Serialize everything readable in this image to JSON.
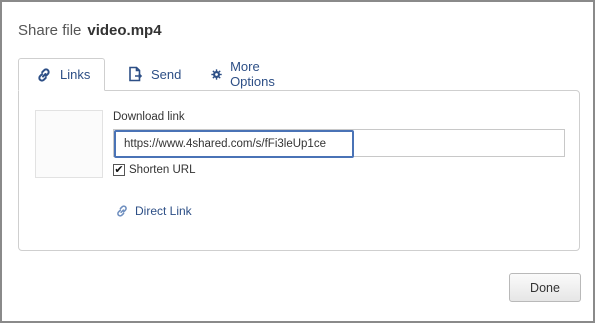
{
  "dialog": {
    "title_prefix": "Share file",
    "filename": "video.mp4"
  },
  "tabs": [
    {
      "label": "Links",
      "icon": "link-icon",
      "active": true
    },
    {
      "label": "Send",
      "icon": "send-file-icon",
      "active": false
    },
    {
      "label": "More Options",
      "icon": "gear-icon",
      "active": false
    }
  ],
  "links_panel": {
    "download_label": "Download link",
    "download_url": "https://www.4shared.com/s/fFi3leUp1ce",
    "shorten_label": "Shorten URL",
    "shorten_checked": true,
    "direct_link_label": "Direct Link"
  },
  "footer": {
    "done_label": "Done"
  },
  "colors": {
    "link": "#2d4f86",
    "focus_border": "#4a73b6"
  }
}
